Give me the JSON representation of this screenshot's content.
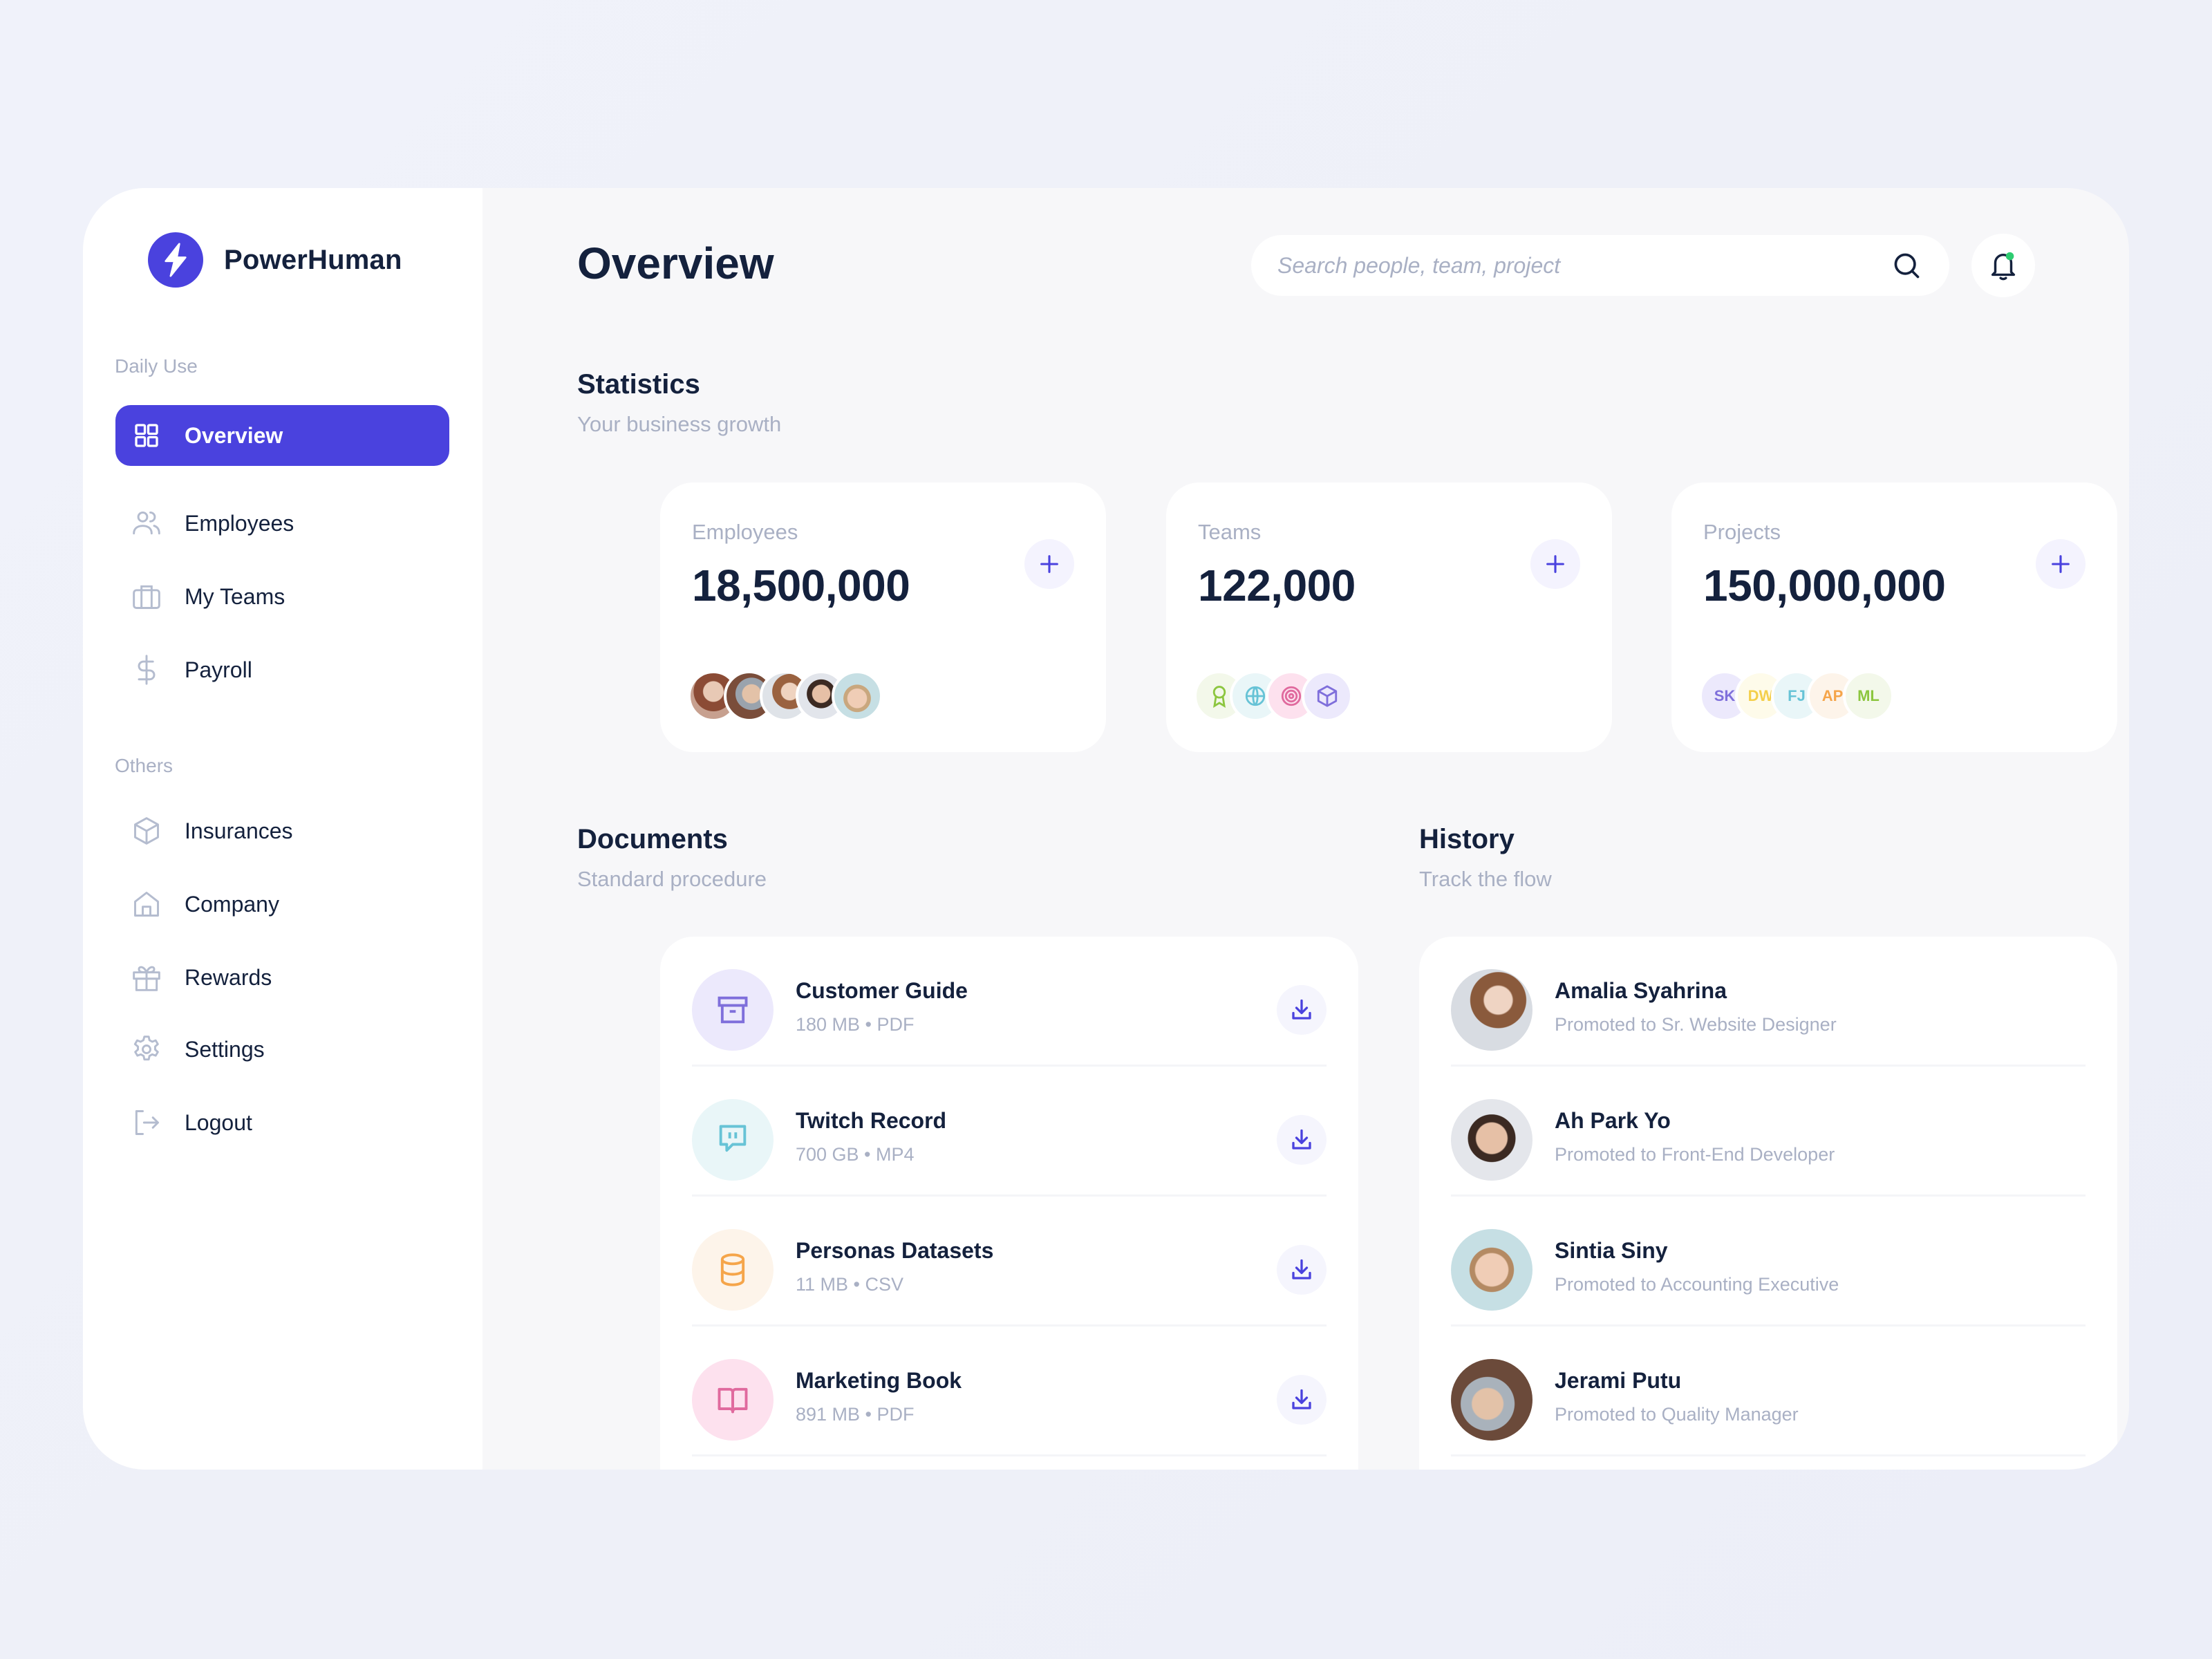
{
  "app": {
    "name": "PowerHuman",
    "accent": "#4a42de"
  },
  "sidebar": {
    "groups": [
      {
        "label": "Daily Use"
      },
      {
        "label": "Others"
      }
    ],
    "items": [
      {
        "label": "Overview",
        "icon": "grid-icon",
        "active": true
      },
      {
        "label": "Employees",
        "icon": "users-icon"
      },
      {
        "label": "My Teams",
        "icon": "briefcase-icon"
      },
      {
        "label": "Payroll",
        "icon": "dollar-icon"
      },
      {
        "label": "Insurances",
        "icon": "box-icon"
      },
      {
        "label": "Company",
        "icon": "home-icon"
      },
      {
        "label": "Rewards",
        "icon": "gift-icon"
      },
      {
        "label": "Settings",
        "icon": "gear-icon"
      },
      {
        "label": "Logout",
        "icon": "logout-icon"
      }
    ]
  },
  "header": {
    "title": "Overview",
    "search_placeholder": "Search people, team, project",
    "notification_dot_color": "#2ecc71"
  },
  "statistics": {
    "title": "Statistics",
    "subtitle": "Your business growth",
    "cards": [
      {
        "label": "Employees",
        "value": "18,500,000",
        "avatars": [
          "avatar-1",
          "avatar-2",
          "avatar-3",
          "avatar-4",
          "avatar-5"
        ]
      },
      {
        "label": "Teams",
        "value": "122,000",
        "team_icons": [
          {
            "icon": "award-icon",
            "bg": "#f3f8ea",
            "fg": "#8cc63f"
          },
          {
            "icon": "globe-icon",
            "bg": "#e9f6f8",
            "fg": "#67c3d6"
          },
          {
            "icon": "target-icon",
            "bg": "#fde1ee",
            "fg": "#e06a9e"
          },
          {
            "icon": "cube-icon",
            "bg": "#ece9fc",
            "fg": "#7f6fdb"
          }
        ]
      },
      {
        "label": "Projects",
        "value": "150,000,000",
        "initials": [
          {
            "text": "SK",
            "bg": "#ece9fc",
            "fg": "#7f6fdb"
          },
          {
            "text": "DW",
            "bg": "#fefbea",
            "fg": "#f4cf4b"
          },
          {
            "text": "FJ",
            "bg": "#e9f6f8",
            "fg": "#67c3d6"
          },
          {
            "text": "AP",
            "bg": "#fdf4ea",
            "fg": "#f5a54a"
          },
          {
            "text": "ML",
            "bg": "#f3f8ea",
            "fg": "#8cc63f"
          }
        ]
      }
    ]
  },
  "documents": {
    "title": "Documents",
    "subtitle": "Standard procedure",
    "items": [
      {
        "name": "Customer Guide",
        "meta": "180 MB • PDF",
        "icon": "archive-icon",
        "bg": "#ece9fc",
        "fg": "#7f6fdb"
      },
      {
        "name": "Twitch Record",
        "meta": "700 GB • MP4",
        "icon": "twitch-icon",
        "bg": "#e9f6f8",
        "fg": "#67c3d6"
      },
      {
        "name": "Personas Datasets",
        "meta": "11 MB • CSV",
        "icon": "database-icon",
        "bg": "#fdf4ea",
        "fg": "#f5a54a"
      },
      {
        "name": "Marketing Book",
        "meta": "891 MB • PDF",
        "icon": "book-icon",
        "bg": "#fde1ee",
        "fg": "#e06a9e"
      }
    ]
  },
  "history": {
    "title": "History",
    "subtitle": "Track the flow",
    "items": [
      {
        "name": "Amalia Syahrina",
        "detail": "Promoted to Sr. Website Designer"
      },
      {
        "name": "Ah Park Yo",
        "detail": "Promoted to Front-End Developer"
      },
      {
        "name": "Sintia Siny",
        "detail": "Promoted to Accounting Executive"
      },
      {
        "name": "Jerami Putu",
        "detail": "Promoted to Quality Manager"
      }
    ]
  }
}
